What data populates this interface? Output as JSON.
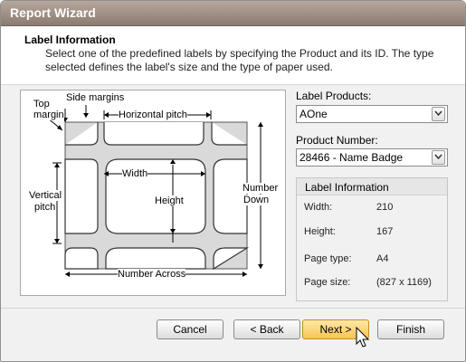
{
  "window": {
    "title": "Report Wizard"
  },
  "header": {
    "title": "Label Information",
    "description": "Select one of the predefined labels by specifying the Product and its ID. The type selected defines the label's size and the type of paper used."
  },
  "diagram": {
    "labels": {
      "side_margins": "Side margins",
      "top_margin_1": "Top",
      "top_margin_2": "margin",
      "horizontal_pitch": "Horizontal pitch",
      "width": "Width",
      "height": "Height",
      "vertical_pitch_1": "Vertical",
      "vertical_pitch_2": "pitch",
      "number_down_1": "Number",
      "number_down_2": "Down",
      "number_across": "Number Across"
    }
  },
  "form": {
    "label_products": {
      "label": "Label Products:",
      "value": "AOne"
    },
    "product_number": {
      "label": "Product Number:",
      "value": "28466 - Name Badge"
    }
  },
  "info": {
    "title": "Label Information",
    "rows": [
      {
        "key": "Width:",
        "value": "210"
      },
      {
        "key": "Height:",
        "value": "167"
      },
      {
        "key": "Page type:",
        "value": "A4"
      },
      {
        "key": "Page size:",
        "value": "(827 x 1169)"
      }
    ]
  },
  "buttons": {
    "cancel": "Cancel",
    "back": "< Back",
    "next": "Next >",
    "finish": "Finish"
  },
  "colors": {
    "accent": "#f8c451",
    "titlebar": "#9b8a7f",
    "label_fill": "#d9d9d9"
  }
}
